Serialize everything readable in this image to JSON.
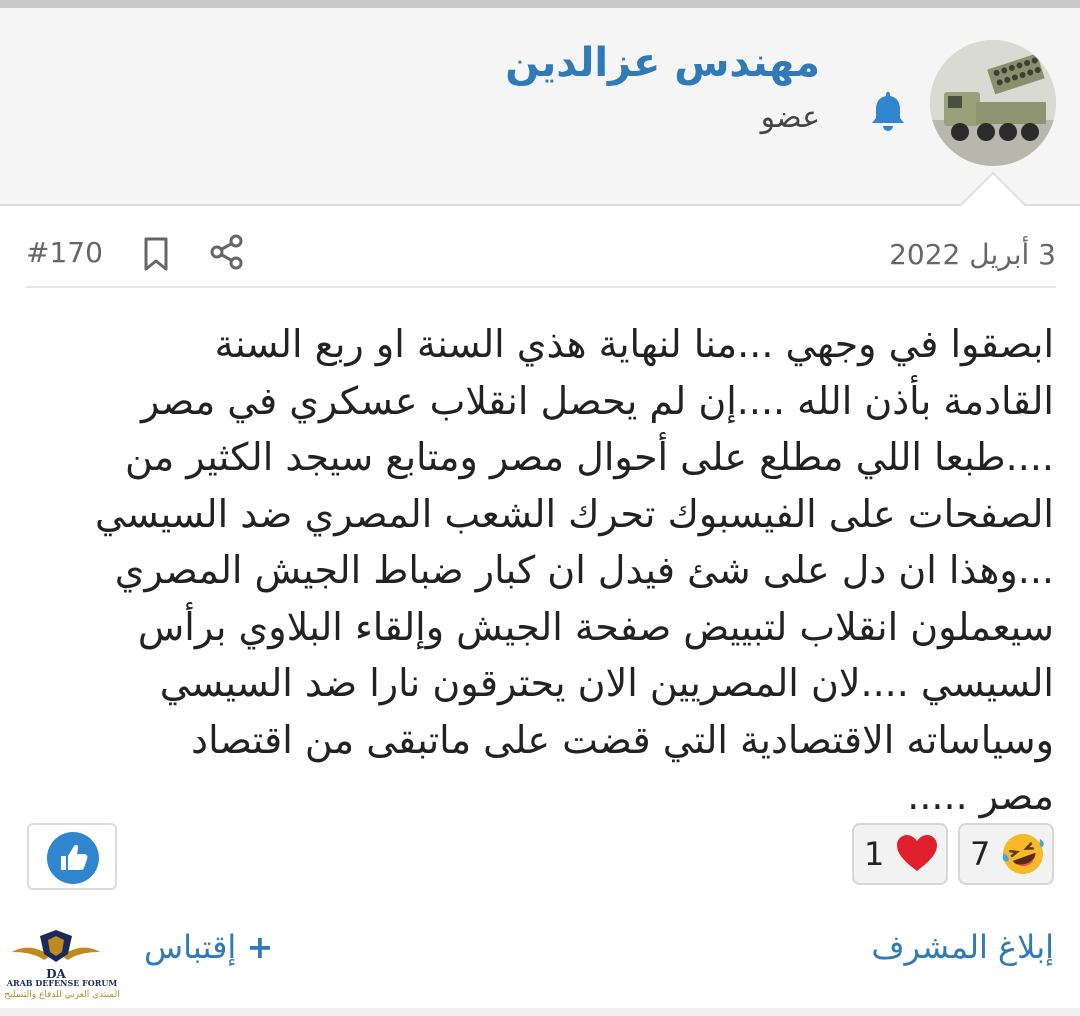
{
  "user": {
    "name": "مهندس عزالدين",
    "role": "عضو"
  },
  "post": {
    "date": "3 أبريل 2022",
    "number": "#170",
    "body": [
      "ابصقوا في وجهي ...منا لنهاية هذي السنة او ربع السنة",
      "القادمة بأذن الله ....إن لم يحصل انقلاب عسكري في مصر",
      "....طبعا اللي مطلع على أحوال مصر ومتابع سيجد الكثير من",
      "الصفحات على الفيسبوك تحرك الشعب المصري ضد السيسي",
      "...وهذا ان دل على شئ فيدل ان كبار ضباط الجيش المصري",
      "سيعملون انقلاب لتبييض صفحة الجيش وإلقاء البلاوي برأس",
      "السيسي ....لان المصريين الان يحترقون نارا ضد السيسي",
      "وسياساته الاقتصادية التي قضت على ماتبقى من اقتصاد",
      "مصر ....."
    ]
  },
  "reactions": {
    "laugh_count": "7",
    "heart_count": "1"
  },
  "actions": {
    "quote_label": "إقتباس",
    "quote_plus": "+",
    "report_label": "إبلاغ المشرف"
  },
  "watermark": {
    "title": "ARAB DEFENSE FORUM",
    "subtitle": "المنتدى العربي للدفاع والتسليح",
    "logo_letters": "DA"
  },
  "colors": {
    "accent": "#2f7ab7",
    "like_blue": "#2f86cf",
    "heart_red": "#e0202c",
    "laugh_yellow": "#f7b928"
  },
  "icons": [
    "bell-icon",
    "bookmark-icon",
    "share-icon",
    "like-icon",
    "laugh-emoji-icon",
    "heart-icon"
  ]
}
